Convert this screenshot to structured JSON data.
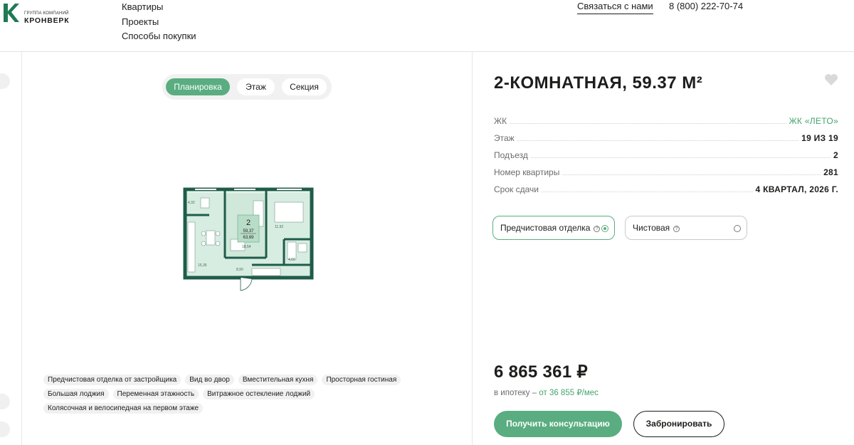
{
  "brand": {
    "subtitle": "ГРУППА КОМПАНИЙ",
    "name": "КРОНВЕРК",
    "color": "#1f7a55"
  },
  "nav": {
    "items": [
      "Квартиры",
      "Проекты",
      "Способы покупки"
    ]
  },
  "header": {
    "contact_label": "Связаться с нами",
    "phone": "8 (800) 222-70-74"
  },
  "tabs": [
    {
      "label": "Планировка",
      "active": true
    },
    {
      "label": "Этаж",
      "active": false
    },
    {
      "label": "Секция",
      "active": false
    }
  ],
  "plan": {
    "rooms_count": "2",
    "area_living": "59,37",
    "area_total": "63,69",
    "room_areas": [
      "4,32",
      "11,92",
      "18,54",
      "15,35",
      "8,90",
      "4,66"
    ]
  },
  "features": {
    "rows": [
      [
        "Предчистовая отделка от застройщика",
        "Вид во двор",
        "Вместительная кухня",
        "Просторная гостиная"
      ],
      [
        "Большая лоджия",
        "Переменная этажность",
        "Витражное остекление лоджий"
      ],
      [
        "Колясочная и велосипедная на первом этаже"
      ]
    ]
  },
  "apartment": {
    "title": "2-КОМНАТНАЯ, 59.37 М²",
    "specs": [
      {
        "label": "ЖК",
        "value": "ЖК «ЛЕТО»",
        "link": true
      },
      {
        "label": "Этаж",
        "value": "19 ИЗ 19",
        "link": false
      },
      {
        "label": "Подъезд",
        "value": "2",
        "link": false
      },
      {
        "label": "Номер квартиры",
        "value": "281",
        "link": false
      },
      {
        "label": "Срок сдачи",
        "value": "4 КВАРТАЛ, 2026 Г.",
        "link": false
      }
    ],
    "finishes": [
      {
        "label": "Предчистовая отделка",
        "selected": true
      },
      {
        "label": "Чистовая",
        "selected": false
      }
    ],
    "price": "6 865 361 ₽",
    "mortgage_prefix": "в ипотеку –",
    "mortgage_amount": "от 36 855 ₽/мес",
    "consult_button": "Получить консультацию",
    "book_button": "Забронировать"
  },
  "colors": {
    "accent": "#5aad80",
    "plan_wall": "#1f5c4a",
    "plan_highlight": "#d7ede1"
  }
}
